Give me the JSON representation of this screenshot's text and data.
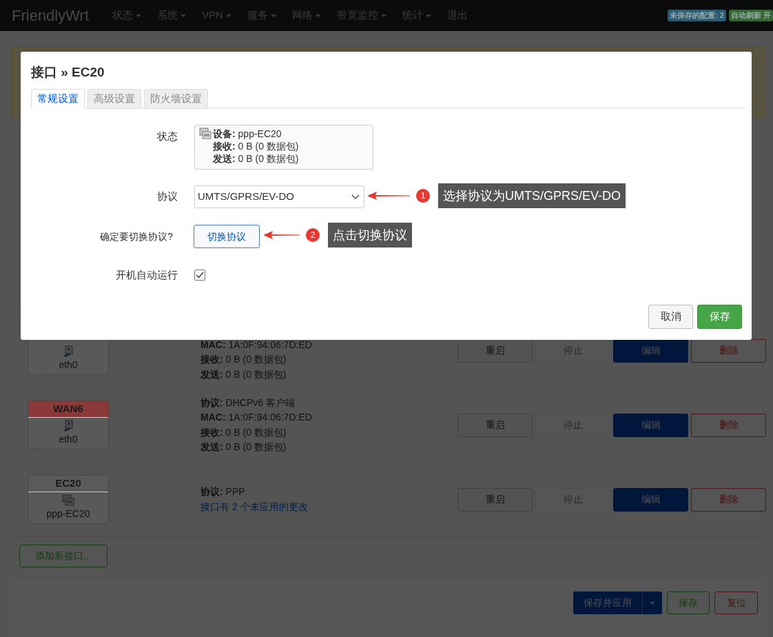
{
  "nav": {
    "brand": "FriendlyWrt",
    "menu": [
      {
        "label": "状态",
        "dropdown": true
      },
      {
        "label": "系统",
        "dropdown": true
      },
      {
        "label": "VPN",
        "dropdown": true
      },
      {
        "label": "服务",
        "dropdown": true
      },
      {
        "label": "网络",
        "dropdown": true
      },
      {
        "label": "带宽监控",
        "dropdown": true
      },
      {
        "label": "统计",
        "dropdown": true
      },
      {
        "label": "退出",
        "dropdown": false
      }
    ],
    "badges": [
      {
        "text": "未保存的配置: 2",
        "color": "#2b5b73"
      },
      {
        "text": "自动刷新 开",
        "color": "#336633"
      }
    ]
  },
  "rows": [
    {
      "kind": "ethernet",
      "device": "eth0",
      "lines": [
        {
          "kind": "field",
          "text": "**MAC:** 1A:0F:94:06:7D:ED"
        },
        {
          "kind": "field",
          "text": "**接收:** 0 B (0 数据包)"
        },
        {
          "kind": "field",
          "text": "**发送:** 0 B (0 数据包)"
        }
      ],
      "actions": [
        {
          "label": "重启",
          "kind": "default"
        },
        {
          "label": "停止",
          "kind": "disabled"
        },
        {
          "label": "编辑",
          "kind": "primary"
        },
        {
          "label": "删除",
          "kind": "danger"
        }
      ]
    },
    {
      "name": "WAN6",
      "color": "#8b3a3a",
      "kind": "ethernet",
      "device": "eth0",
      "lines": [
        {
          "kind": "field",
          "text": "**协议:** DHCPv6 客户端"
        },
        {
          "kind": "field",
          "text": "**MAC:** 1A:0F:94:06:7D:ED"
        },
        {
          "kind": "field",
          "text": "**接收:** 0 B (0 数据包)"
        },
        {
          "kind": "field",
          "text": "**发送:** 0 B (0 数据包)"
        }
      ],
      "actions": [
        {
          "label": "重启",
          "kind": "default"
        },
        {
          "label": "停止",
          "kind": "disabled"
        },
        {
          "label": "编辑",
          "kind": "primary"
        },
        {
          "label": "删除",
          "kind": "danger"
        }
      ]
    },
    {
      "name": "EC20",
      "color": "#5a5a5a",
      "kind": "modem",
      "device": "ppp-EC20",
      "lines": [
        {
          "kind": "field",
          "text": "**协议:** PPP"
        },
        {
          "kind": "link",
          "text": "接口有 2 个未应用的更改"
        }
      ],
      "actions": [
        {
          "label": "重启",
          "kind": "default"
        },
        {
          "label": "停止",
          "kind": "disabled"
        },
        {
          "label": "编辑",
          "kind": "primary"
        },
        {
          "label": "删除",
          "kind": "danger"
        }
      ]
    }
  ],
  "add_button": "添加新接口...",
  "footer": {
    "save_apply": "保存并应用",
    "save": "保存",
    "reset": "复位"
  },
  "modal": {
    "title": "接口 » EC20",
    "tabs": [
      {
        "label": "常规设置",
        "selected": true
      },
      {
        "label": "高级设置",
        "selected": false
      },
      {
        "label": "防火墙设置",
        "selected": false
      }
    ],
    "status_label": "状态",
    "status_lines": [
      "**设备:** ppp-EC20",
      "**接收:** 0 B (0 数据包)",
      "**发送:** 0 B (0 数据包)"
    ],
    "protocol_label": "协议",
    "protocol_value": "UMTS/GPRS/EV-DO",
    "switch_label": "确定要切换协议?",
    "switch_button": "切换协议",
    "autostart_label": "开机自动运行",
    "autostart_checked": true,
    "cancel": "取消",
    "save": "保存"
  },
  "callouts": [
    {
      "number": "1",
      "text": "选择协议为UMTS/GPRS/EV-DO"
    },
    {
      "number": "2",
      "text": "点击切换协议"
    }
  ]
}
